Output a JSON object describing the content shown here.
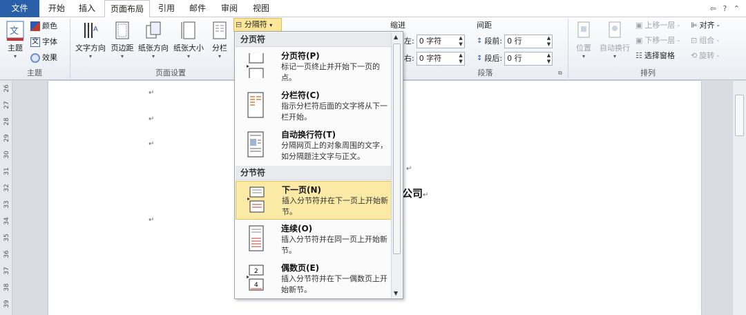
{
  "tabs": {
    "file": "文件",
    "home": "开始",
    "insert": "插入",
    "layout": "页面布局",
    "references": "引用",
    "mailings": "邮件",
    "review": "审阅",
    "view": "视图",
    "right_icons": "⇦ ? ⌃"
  },
  "ribbon": {
    "theme_group": {
      "label": "主题",
      "theme_btn": "主题",
      "colors": "颜色",
      "fonts": "字体",
      "effects": "效果"
    },
    "page_setup_group": {
      "label": "页面设置",
      "text_direction": "文字方向",
      "margins": "页边距",
      "orientation": "纸张方向",
      "size": "纸张大小",
      "columns": "分栏",
      "breaks": "分隔符"
    },
    "paragraph_group": {
      "label": "段落",
      "indent_title": "缩进",
      "spacing_title": "间距",
      "indent_left_label": "左:",
      "indent_left_value": "0 字符",
      "indent_right_label": "右:",
      "indent_right_value": "0 字符",
      "space_before_label": "段前:",
      "space_before_value": "0 行",
      "space_after_label": "段后:",
      "space_after_value": "0 行"
    },
    "arrange_group": {
      "label": "排列",
      "position": "位置",
      "wrap": "自动换行",
      "bring_forward": "上移一层",
      "send_backward": "下移一层",
      "selection_pane": "选择窗格",
      "align": "对齐",
      "group": "组合",
      "rotate": "旋转"
    }
  },
  "ruler_numbers": [
    "26",
    "27",
    "28",
    "29",
    "30",
    "31",
    "32",
    "33",
    "34",
    "35",
    "36",
    "37",
    "38",
    "39"
  ],
  "document": {
    "visible_text": "公司"
  },
  "breaks_menu": {
    "page_breaks_header": "分页符",
    "section_breaks_header": "分节符",
    "items": [
      {
        "title": "分页符(P)",
        "desc": "标记一页终止并开始下一页的点。"
      },
      {
        "title": "分栏符(C)",
        "desc": "指示分栏符后面的文字将从下一栏开始。"
      },
      {
        "title": "自动换行符(T)",
        "desc": "分隔网页上的对象周围的文字，如分隔题注文字与正文。"
      },
      {
        "title": "下一页(N)",
        "desc": "插入分节符并在下一页上开始新节。"
      },
      {
        "title": "连续(O)",
        "desc": "插入分节符并在同一页上开始新节。"
      },
      {
        "title": "偶数页(E)",
        "desc": "插入分节符并在下一偶数页上开始新节。"
      }
    ]
  },
  "colors": {
    "file_tab": "#2a5faa",
    "highlight": "#fbe9a6"
  }
}
